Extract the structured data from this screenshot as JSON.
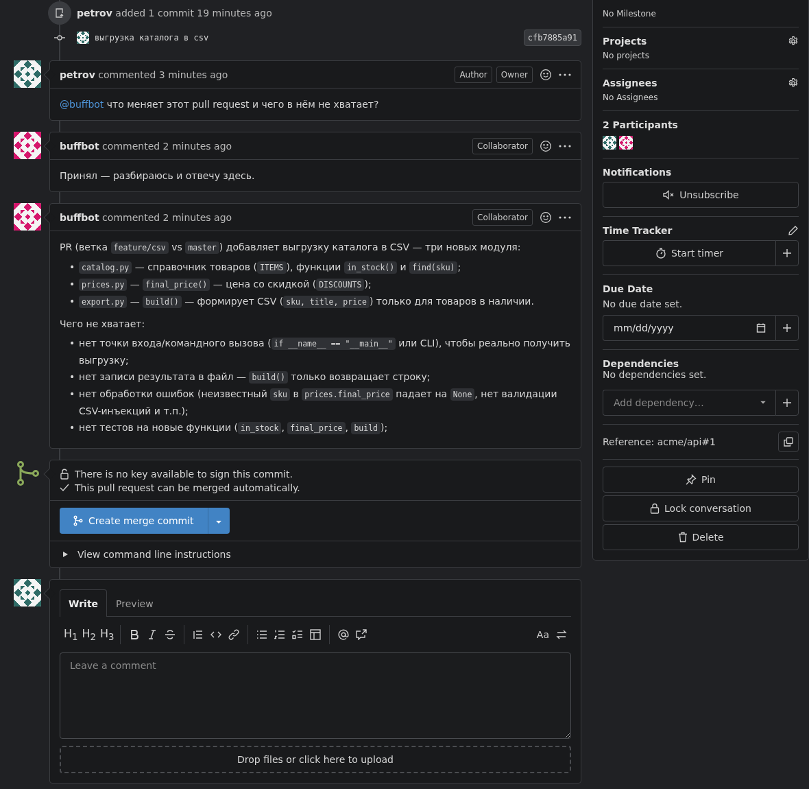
{
  "timeline_event": {
    "user": "petrov",
    "text": "added 1 commit 19 minutes ago"
  },
  "commits": [
    {
      "message": "выгрузка каталога в csv",
      "sha": "cfb7885a91",
      "color": "#2e6b66"
    }
  ],
  "comments": [
    {
      "author": "petrov",
      "meta": "commented 3 minutes ago",
      "color": "#2e6b66",
      "badges": [
        "Author",
        "Owner"
      ],
      "body": [
        {
          "kind": "paragraph",
          "segments": [
            {
              "kind": "mention",
              "text": "@buffbot"
            },
            {
              "kind": "text",
              "text": " что меняет этот pull request и чего в нём не хватает?"
            }
          ]
        }
      ]
    },
    {
      "author": "buffbot",
      "meta": "commented 2 minutes ago",
      "color": "#d5156c",
      "badges": [
        "Collaborator"
      ],
      "body": [
        {
          "kind": "paragraph",
          "segments": [
            {
              "kind": "text",
              "text": "Принял — разбираюсь и отвечу здесь."
            }
          ]
        }
      ]
    },
    {
      "author": "buffbot",
      "meta": "commented 2 minutes ago",
      "color": "#d5156c",
      "badges": [
        "Collaborator"
      ],
      "body": [
        {
          "kind": "paragraph",
          "segments": [
            {
              "kind": "text",
              "text": "PR (ветка "
            },
            {
              "kind": "code",
              "text": "feature/csv"
            },
            {
              "kind": "text",
              "text": " vs "
            },
            {
              "kind": "code",
              "text": "master"
            },
            {
              "kind": "text",
              "text": ") добавляет выгрузку каталога в CSV — три новых модуля:"
            }
          ]
        },
        {
          "kind": "list",
          "marker": "•",
          "items": [
            [
              {
                "kind": "code",
                "text": "catalog.py"
              },
              {
                "kind": "text",
                "text": " — справочник товаров ("
              },
              {
                "kind": "code",
                "text": "ITEMS"
              },
              {
                "kind": "text",
                "text": "), функции "
              },
              {
                "kind": "code",
                "text": "in_stock()"
              },
              {
                "kind": "text",
                "text": " и "
              },
              {
                "kind": "code",
                "text": "find(sku)"
              },
              {
                "kind": "text",
                "text": ";"
              }
            ],
            [
              {
                "kind": "code",
                "text": "prices.py"
              },
              {
                "kind": "text",
                "text": " — "
              },
              {
                "kind": "code",
                "text": "final_price()"
              },
              {
                "kind": "text",
                "text": " — цена со скидкой ("
              },
              {
                "kind": "code",
                "text": "DISCOUNTS"
              },
              {
                "kind": "text",
                "text": ");"
              }
            ],
            [
              {
                "kind": "code",
                "text": "export.py"
              },
              {
                "kind": "text",
                "text": " — "
              },
              {
                "kind": "code",
                "text": "build()"
              },
              {
                "kind": "text",
                "text": " — формирует CSV ("
              },
              {
                "kind": "code",
                "text": "sku, title, price"
              },
              {
                "kind": "text",
                "text": ") только для товаров в наличии."
              }
            ]
          ]
        },
        {
          "kind": "paragraph",
          "segments": [
            {
              "kind": "text",
              "text": "Чего не хватает:"
            }
          ]
        },
        {
          "kind": "list",
          "marker": "•",
          "items": [
            [
              {
                "kind": "text",
                "text": "нет точки входа/командного вызова ("
              },
              {
                "kind": "code",
                "text": "if __name__ == \"__main__\""
              },
              {
                "kind": "text",
                "text": " или CLI), чтобы реально получить выгрузку;"
              }
            ],
            [
              {
                "kind": "text",
                "text": "нет записи результата в файл — "
              },
              {
                "kind": "code",
                "text": "build()"
              },
              {
                "kind": "text",
                "text": " только возвращает строку;"
              }
            ],
            [
              {
                "kind": "text",
                "text": "нет обработки ошибок (неизвестный "
              },
              {
                "kind": "code",
                "text": "sku"
              },
              {
                "kind": "text",
                "text": " в "
              },
              {
                "kind": "code",
                "text": "prices.final_price"
              },
              {
                "kind": "text",
                "text": " падает на "
              },
              {
                "kind": "code",
                "text": "None"
              },
              {
                "kind": "text",
                "text": ", нет валидации CSV-инъекций и т.п.);"
              }
            ],
            [
              {
                "kind": "text",
                "text": "нет тестов на новые функции ("
              },
              {
                "kind": "code",
                "text": "in_stock"
              },
              {
                "kind": "text",
                "text": ", "
              },
              {
                "kind": "code",
                "text": "final_price"
              },
              {
                "kind": "text",
                "text": ", "
              },
              {
                "kind": "code",
                "text": "build"
              },
              {
                "kind": "text",
                "text": ");"
              }
            ]
          ]
        }
      ]
    }
  ],
  "merge": {
    "messages": [
      {
        "kind": "unlocked",
        "text": "There is no key available to sign this commit."
      },
      {
        "kind": "check",
        "text": "This pull request can be merged automatically."
      }
    ],
    "button": "Create merge commit",
    "instructions": "View command line instructions"
  },
  "editor": {
    "color": "#2e6b66",
    "tabs": [
      {
        "label": "Write",
        "selected": true
      },
      {
        "label": "Preview",
        "selected": false
      }
    ],
    "headings": [
      "H$_{1}$",
      "H$_{2}$",
      "H$_{3}$"
    ],
    "text_toggle": "Aa",
    "placeholder": "Leave a comment",
    "dropzone": "Drop files or click here to upload"
  },
  "sidebar": [
    {
      "kind": "note",
      "value": "No Milestone"
    },
    {
      "kind": "setting",
      "title": "Projects",
      "value": "No projects"
    },
    {
      "kind": "setting",
      "title": "Assignees",
      "value": "No Assignees"
    },
    {
      "kind": "participants",
      "title": "2 Participants",
      "avatars": [
        {
          "color": "#2e6b66"
        },
        {
          "color": "#d5156c"
        }
      ]
    },
    {
      "kind": "notifications",
      "title": "Notifications",
      "button": "Unsubscribe"
    },
    {
      "kind": "time_tracker",
      "title": "Time Tracker",
      "button": "Start timer"
    },
    {
      "kind": "due_date",
      "title": "Due Date",
      "value": "No due date set.",
      "placeholder": "mm/dd/yyyy"
    },
    {
      "kind": "dependencies",
      "title": "Dependencies",
      "value": "No dependencies set.",
      "placeholder": "Add dependency…"
    },
    {
      "kind": "reference",
      "value": "Reference: acme/api#1"
    },
    {
      "kind": "actions",
      "buttons": [
        "Pin",
        "Lock conversation",
        "Delete"
      ]
    }
  ]
}
